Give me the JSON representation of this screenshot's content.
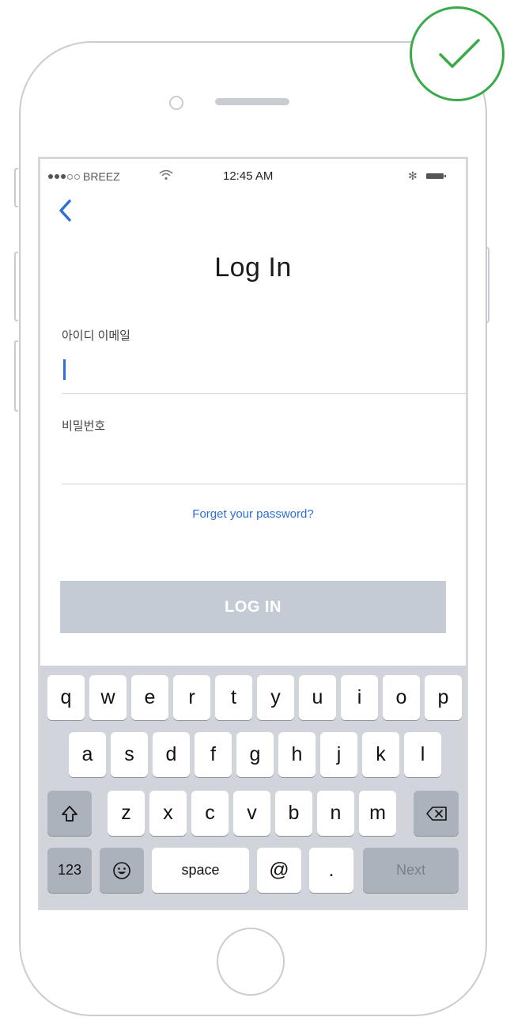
{
  "status_bar": {
    "carrier": "BREEZ",
    "time": "12:45 AM"
  },
  "page": {
    "title": "Log In"
  },
  "form": {
    "id_label": "아이디 이메일",
    "id_value": "",
    "password_label": "비밀번호",
    "password_value": "",
    "forgot_link": "Forget your password?",
    "login_button": "LOG IN"
  },
  "keyboard": {
    "row1": [
      "q",
      "w",
      "e",
      "r",
      "t",
      "y",
      "u",
      "i",
      "o",
      "p"
    ],
    "row2": [
      "a",
      "s",
      "d",
      "f",
      "g",
      "h",
      "j",
      "k",
      "l"
    ],
    "row3": [
      "z",
      "x",
      "c",
      "v",
      "b",
      "n",
      "m"
    ],
    "numbers_key": "123",
    "space_key": "space",
    "at_key": "@",
    "dot_key": ".",
    "next_key": "Next"
  },
  "colors": {
    "accent": "#2f6fd6",
    "success": "#3aaa4a",
    "button_disabled": "#c5cbd4",
    "keyboard_bg": "#d1d5db"
  }
}
